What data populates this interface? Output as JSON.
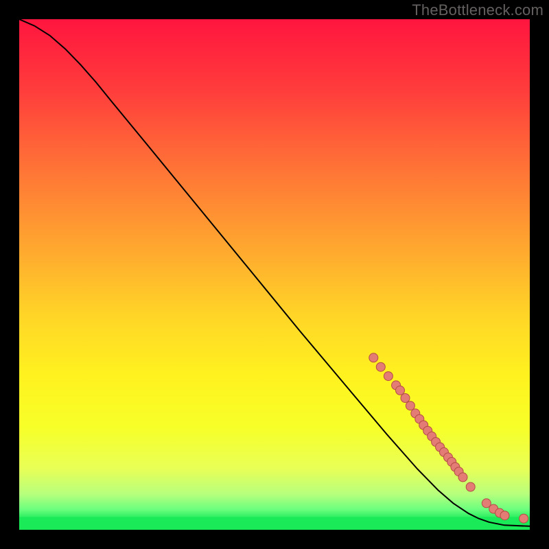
{
  "watermark": "TheBottleneck.com",
  "colors": {
    "frame_bg": "#000000",
    "watermark": "#64605f",
    "curve": "#000000",
    "marker_fill": "#e37c74",
    "marker_stroke": "#b34c44",
    "green_band": "#1bea58"
  },
  "chart_data": {
    "type": "line",
    "title": "",
    "xlabel": "",
    "ylabel": "",
    "xlim": [
      0,
      100
    ],
    "ylim": [
      0,
      100
    ],
    "gradient_stops": [
      {
        "pct": 0,
        "color": "#ff153e"
      },
      {
        "pct": 14,
        "color": "#ff3d3c"
      },
      {
        "pct": 30,
        "color": "#ff7636"
      },
      {
        "pct": 45,
        "color": "#ffa82f"
      },
      {
        "pct": 58,
        "color": "#ffd527"
      },
      {
        "pct": 70,
        "color": "#fff21f"
      },
      {
        "pct": 80,
        "color": "#f7ff29"
      },
      {
        "pct": 88,
        "color": "#e8ff56"
      },
      {
        "pct": 93,
        "color": "#b7ff7d"
      },
      {
        "pct": 96,
        "color": "#6cff7e"
      },
      {
        "pct": 98,
        "color": "#1bea58"
      },
      {
        "pct": 100,
        "color": "#1bea58"
      }
    ],
    "curve_points": [
      {
        "x": 0.0,
        "y": 100.0
      },
      {
        "x": 3.0,
        "y": 98.7
      },
      {
        "x": 6.0,
        "y": 96.8
      },
      {
        "x": 9.0,
        "y": 94.2
      },
      {
        "x": 12.0,
        "y": 91.1
      },
      {
        "x": 15.0,
        "y": 87.7
      },
      {
        "x": 18.0,
        "y": 84.0
      },
      {
        "x": 25.0,
        "y": 75.5
      },
      {
        "x": 35.0,
        "y": 63.3
      },
      {
        "x": 45.0,
        "y": 51.1
      },
      {
        "x": 55.0,
        "y": 38.9
      },
      {
        "x": 65.0,
        "y": 27.0
      },
      {
        "x": 72.0,
        "y": 18.7
      },
      {
        "x": 78.0,
        "y": 11.9
      },
      {
        "x": 82.0,
        "y": 7.8
      },
      {
        "x": 85.0,
        "y": 5.2
      },
      {
        "x": 88.0,
        "y": 3.2
      },
      {
        "x": 90.0,
        "y": 2.2
      },
      {
        "x": 92.0,
        "y": 1.5
      },
      {
        "x": 95.0,
        "y": 0.9
      },
      {
        "x": 100.0,
        "y": 0.7
      }
    ],
    "segment_markers": [
      {
        "x": 69.4,
        "y": 33.7
      },
      {
        "x": 70.8,
        "y": 31.9
      },
      {
        "x": 72.3,
        "y": 30.1
      },
      {
        "x": 73.8,
        "y": 28.3
      },
      {
        "x": 74.6,
        "y": 27.3
      },
      {
        "x": 75.6,
        "y": 25.8
      },
      {
        "x": 76.6,
        "y": 24.3
      },
      {
        "x": 77.6,
        "y": 22.8
      },
      {
        "x": 78.4,
        "y": 21.7
      },
      {
        "x": 79.2,
        "y": 20.5
      },
      {
        "x": 80.0,
        "y": 19.4
      },
      {
        "x": 80.8,
        "y": 18.3
      },
      {
        "x": 81.6,
        "y": 17.2
      },
      {
        "x": 82.4,
        "y": 16.2
      },
      {
        "x": 83.2,
        "y": 15.2
      },
      {
        "x": 84.0,
        "y": 14.2
      },
      {
        "x": 84.7,
        "y": 13.3
      },
      {
        "x": 85.4,
        "y": 12.3
      },
      {
        "x": 86.1,
        "y": 11.4
      },
      {
        "x": 86.9,
        "y": 10.3
      }
    ],
    "tail_markers": [
      {
        "x": 88.4,
        "y": 8.4
      },
      {
        "x": 91.5,
        "y": 5.2
      },
      {
        "x": 92.9,
        "y": 4.1
      },
      {
        "x": 94.1,
        "y": 3.3
      },
      {
        "x": 95.1,
        "y": 2.8
      },
      {
        "x": 98.8,
        "y": 2.2
      }
    ]
  }
}
